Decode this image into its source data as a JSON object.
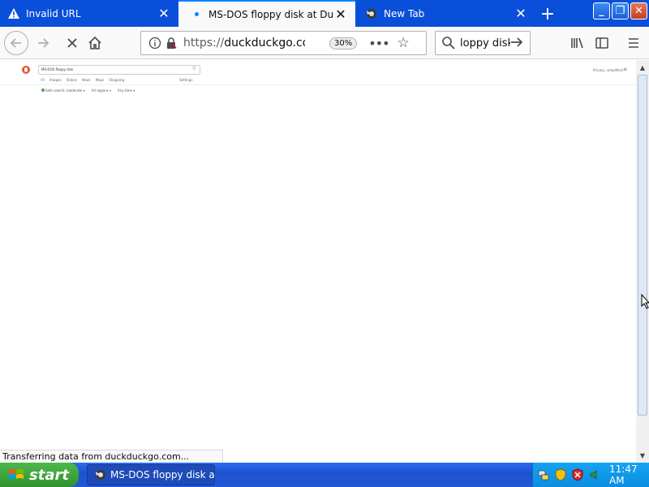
{
  "browser": {
    "tabs": [
      {
        "title": "Invalid URL",
        "active": false,
        "icon": "warning-icon"
      },
      {
        "title": "MS-DOS floppy disk at DuckDuckGo",
        "active": true,
        "icon": "loading-dot-icon"
      },
      {
        "title": "New Tab",
        "active": false,
        "icon": "firefox-icon"
      }
    ],
    "url_prefix": "https://",
    "url_text": "duckduckgo.com/?",
    "zoom": "30%",
    "search_value": "loppy disk",
    "status_text": "Transferring data from duckduckgo.com..."
  },
  "ddg": {
    "search_value": "MS-DOS floppy disk",
    "tabs": [
      "All",
      "Images",
      "Videos",
      "News",
      "Maps",
      "Shopping"
    ],
    "settings_label": "Settings",
    "right_links": "Privacy, simplified.",
    "filters": [
      "Safe search: moderate",
      "All regions",
      "Any time"
    ]
  },
  "taskbar": {
    "start_label": "start",
    "task_item": "MS-DOS floppy disk a...",
    "clock": "11:47 AM"
  },
  "colors": {
    "tabstrip": "#0a4fd9",
    "accent": "#0a84ff",
    "ddg_orange": "#de5833",
    "taskbar": "#2058d6",
    "start": "#3a9a3a"
  }
}
